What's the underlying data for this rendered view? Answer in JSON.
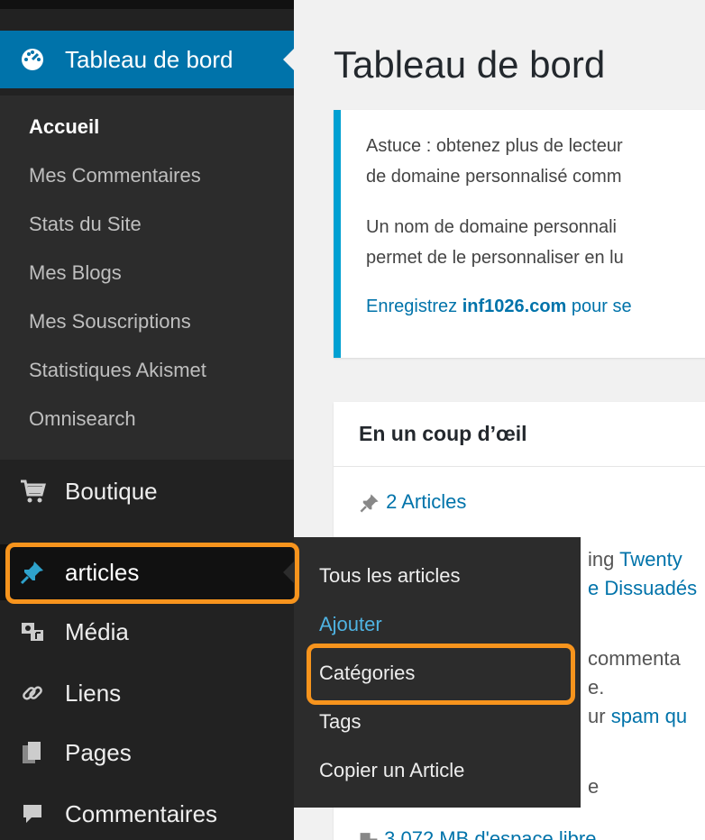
{
  "sidebar": {
    "dashboard_label": "Tableau de bord",
    "submenu": [
      "Accueil",
      "Mes Commentaires",
      "Stats du Site",
      "Mes Blogs",
      "Mes Souscriptions",
      "Statistiques Akismet",
      "Omnisearch"
    ],
    "menu": {
      "boutique": "Boutique",
      "articles": "articles",
      "media": "Média",
      "liens": "Liens",
      "pages": "Pages",
      "commentaires": "Commentaires"
    },
    "icons": {
      "dashboard": "dashboard-icon",
      "boutique": "cart-icon",
      "articles": "pin-icon",
      "media": "media-icon",
      "liens": "link-icon",
      "pages": "pages-icon",
      "commentaires": "comment-icon"
    }
  },
  "flyout": {
    "items": [
      "Tous les articles",
      "Ajouter",
      "Catégories",
      "Tags",
      "Copier un Article"
    ]
  },
  "main": {
    "title": "Tableau de bord",
    "notice": {
      "line1": "Astuce : obtenez plus de lecteur",
      "line2": "de domaine personnalisé comm",
      "line3": "Un nom de domaine personnali",
      "line4": "permet de le personnaliser en lu",
      "line5_pre": "Enregistrez ",
      "line5_link": "inf1026.com",
      "line5_post": " pour se"
    },
    "glance": {
      "title": "En un coup d’œil",
      "articles_count": "2 Articles",
      "theme_pre": "ing ",
      "theme_link": "Twenty",
      "dissuade": "e Dissuadés",
      "comments": "commenta",
      "period": "e.",
      "spam_pre": "ur ",
      "spam_link": "spam qu",
      "extra": "e",
      "space": "3 072 MB d'espace libre"
    }
  },
  "colors": {
    "accent": "#0073aa",
    "highlight": "#f7941d",
    "sidebar_bg": "#222222",
    "notice_border": "#00a0d2"
  }
}
